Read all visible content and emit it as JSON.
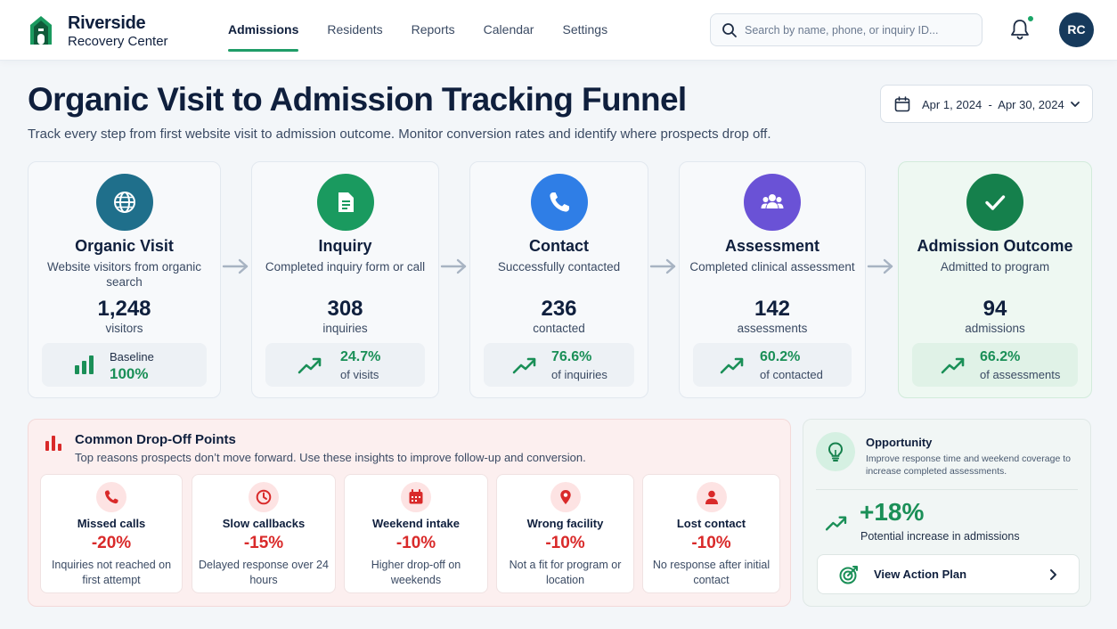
{
  "brand": {
    "line1": "Riverside",
    "line2": "Recovery Center"
  },
  "nav": [
    {
      "label": "Admissions",
      "active": true
    },
    {
      "label": "Residents",
      "active": false
    },
    {
      "label": "Reports",
      "active": false
    },
    {
      "label": "Calendar",
      "active": false
    },
    {
      "label": "Settings",
      "active": false
    }
  ],
  "search": {
    "placeholder": "Search by name, phone, or inquiry ID..."
  },
  "user": {
    "initials": "RC"
  },
  "page": {
    "title": "Organic Visit to Admission Tracking Funnel",
    "subtitle": "Track every step from first website visit to admission outcome. Monitor conversion rates and identify where prospects drop off."
  },
  "date_range": {
    "label": "Apr 1, 2024  -  Apr 30, 2024"
  },
  "funnel": [
    {
      "stage": "Organic Visit",
      "desc": "Website visitors from organic search",
      "count": "1,248",
      "unit": "visitors",
      "metric_label": "Baseline",
      "metric_value": "100%",
      "icon": "globe-icon",
      "color": "#1f6f8b"
    },
    {
      "stage": "Inquiry",
      "desc": "Completed inquiry form or call",
      "count": "308",
      "unit": "inquiries",
      "metric_value": "24.7%",
      "metric_label": "of visits",
      "icon": "document-icon",
      "color": "#1a9a5f"
    },
    {
      "stage": "Contact",
      "desc": "Successfully contacted",
      "count": "236",
      "unit": "contacted",
      "metric_value": "76.6%",
      "metric_label": "of inquiries",
      "icon": "phone-icon",
      "color": "#2f7ee6"
    },
    {
      "stage": "Assessment",
      "desc": "Completed clinical assessment",
      "count": "142",
      "unit": "assessments",
      "metric_value": "60.2%",
      "metric_label": "of contacted",
      "icon": "people-icon",
      "color": "#6a52d6"
    },
    {
      "stage": "Admission Outcome",
      "desc": "Admitted to program",
      "count": "94",
      "unit": "admissions",
      "metric_value": "66.2%",
      "metric_label": "of assessments",
      "icon": "check-icon",
      "color": "#15804c"
    }
  ],
  "dropoff": {
    "title": "Common Drop-Off Points",
    "subtitle": "Top reasons prospects don’t move forward. Use these insights to improve follow-up and conversion.",
    "items": [
      {
        "title": "Missed calls",
        "value": "-20%",
        "desc": "Inquiries not reached on first attempt",
        "icon": "phone-icon"
      },
      {
        "title": "Slow callbacks",
        "value": "-15%",
        "desc": "Delayed response over 24 hours",
        "icon": "clock-icon"
      },
      {
        "title": "Weekend intake",
        "value": "-10%",
        "desc": "Higher drop-off on weekends",
        "icon": "calendar-icon"
      },
      {
        "title": "Wrong facility",
        "value": "-10%",
        "desc": "Not a fit for program or location",
        "icon": "location-pin-icon"
      },
      {
        "title": "Lost contact",
        "value": "-10%",
        "desc": "No response after initial contact",
        "icon": "person-icon"
      }
    ]
  },
  "opportunity": {
    "title": "Opportunity",
    "desc": "Improve response time and weekend coverage to increase completed assessments.",
    "value": "+18%",
    "value_label": "Potential increase in admissions",
    "button_label": "View Action Plan"
  }
}
